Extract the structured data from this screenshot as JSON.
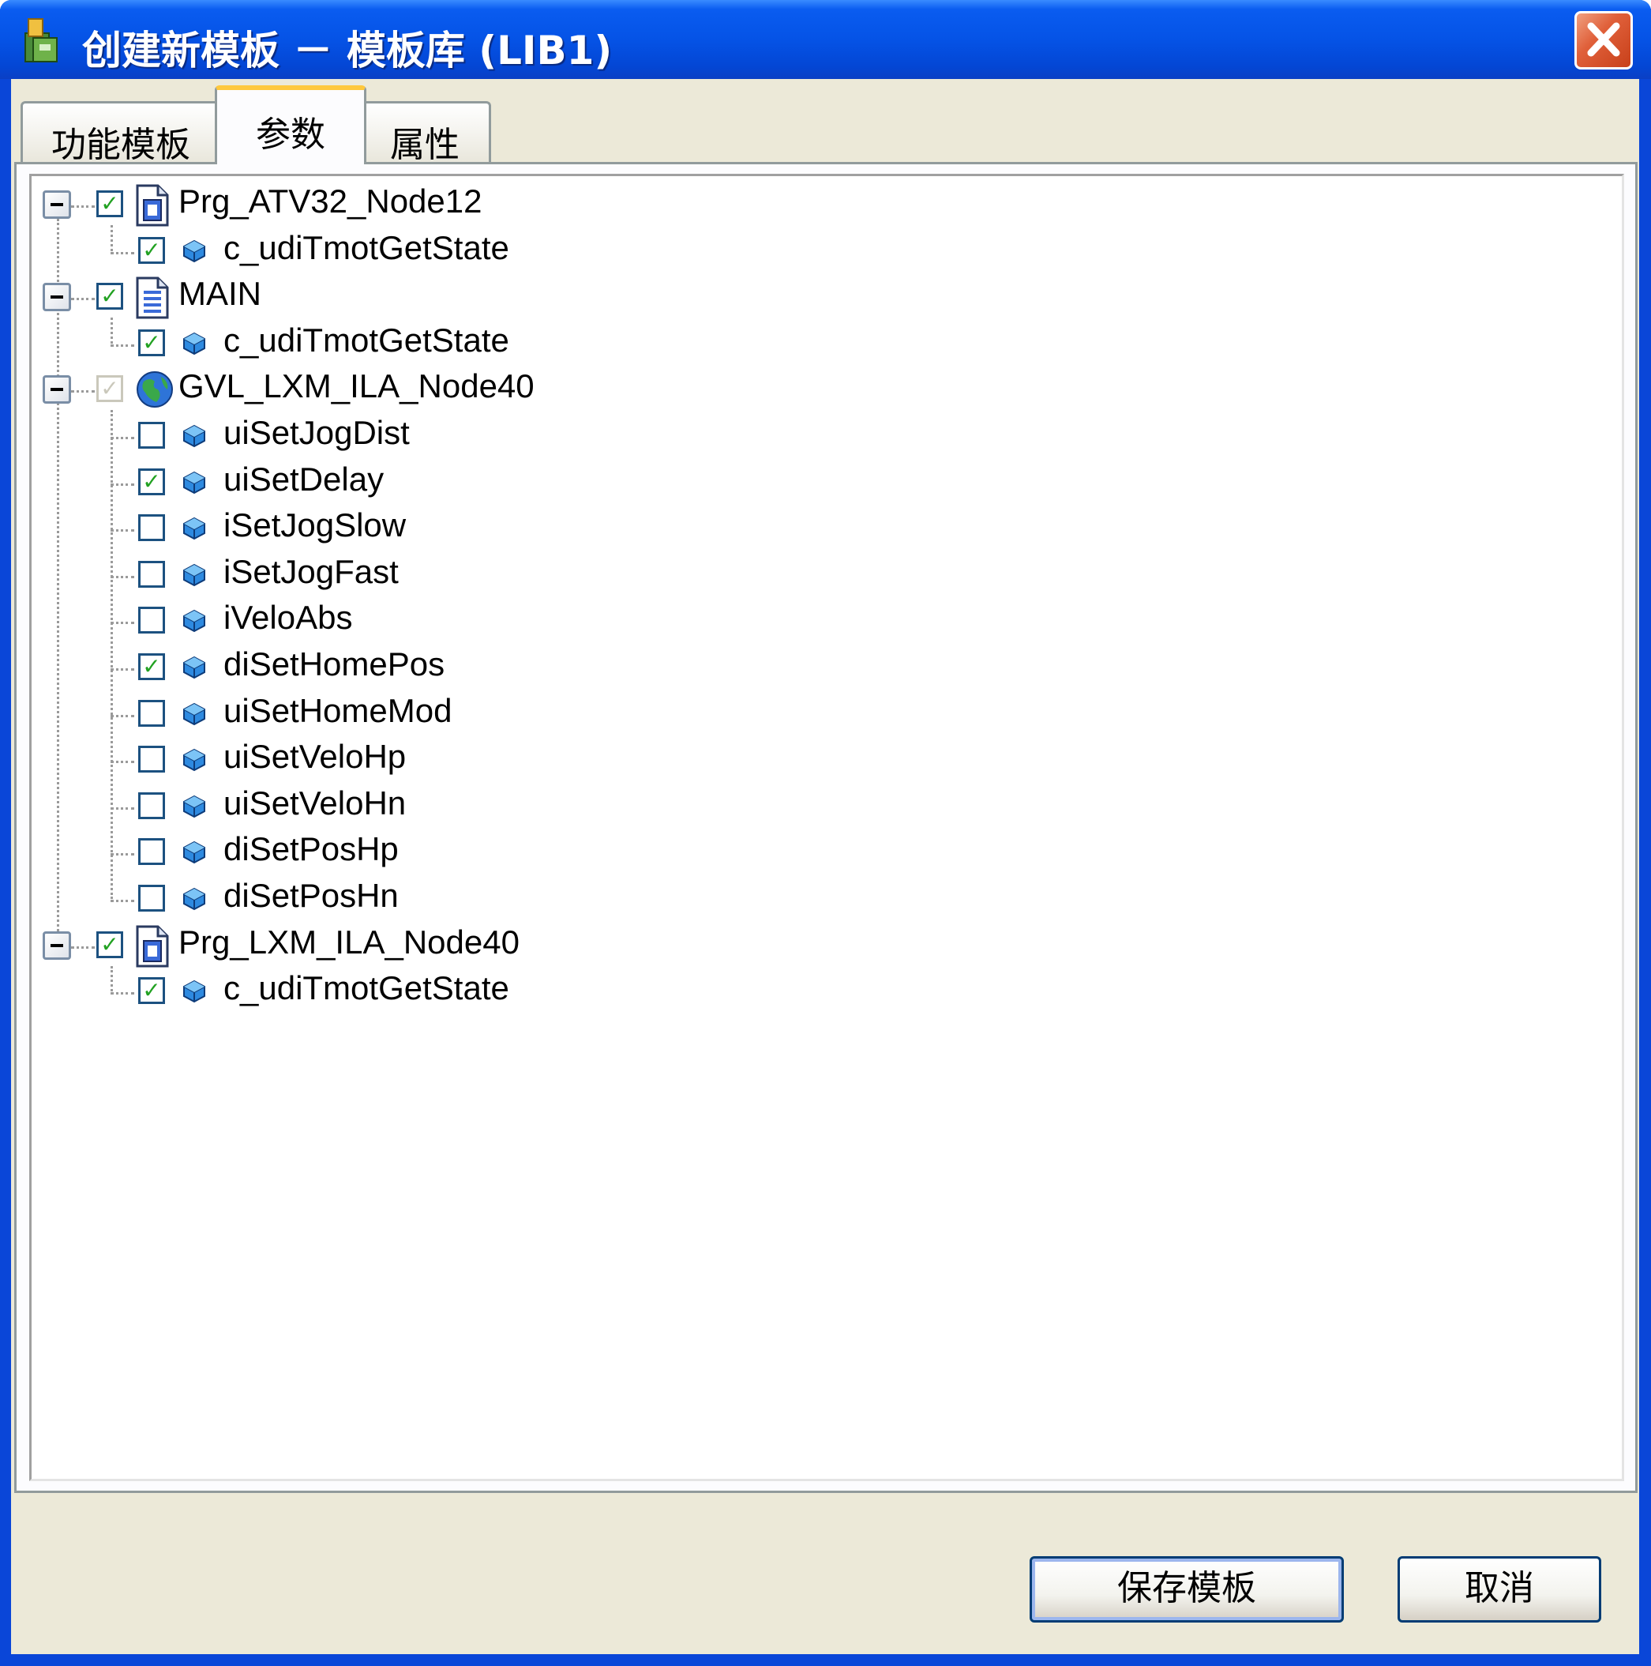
{
  "window": {
    "title": "创建新模板 － 模板库 (LIB1)"
  },
  "tabs": [
    {
      "label": "功能模板"
    },
    {
      "label": "参数"
    },
    {
      "label": "属性"
    }
  ],
  "active_tab": "参数",
  "tree": {
    "groups": [
      {
        "label": "Prg_ATV32_Node12",
        "icon": "program-icon",
        "checked": true,
        "items": [
          {
            "label": "c_udiTmotGetState",
            "checked": true
          }
        ]
      },
      {
        "label": "MAIN",
        "icon": "document-icon",
        "checked": true,
        "items": [
          {
            "label": "c_udiTmotGetState",
            "checked": true
          }
        ]
      },
      {
        "label": "GVL_LXM_ILA_Node40",
        "icon": "globe-icon",
        "checked": true,
        "disabled": true,
        "items": [
          {
            "label": "uiSetJogDist",
            "checked": false
          },
          {
            "label": "uiSetDelay",
            "checked": true
          },
          {
            "label": "iSetJogSlow",
            "checked": false
          },
          {
            "label": "iSetJogFast",
            "checked": false
          },
          {
            "label": "iVeloAbs",
            "checked": false
          },
          {
            "label": "diSetHomePos",
            "checked": true
          },
          {
            "label": "uiSetHomeMod",
            "checked": false
          },
          {
            "label": "uiSetVeloHp",
            "checked": false
          },
          {
            "label": "uiSetVeloHn",
            "checked": false
          },
          {
            "label": "diSetPosHp",
            "checked": false
          },
          {
            "label": "diSetPosHn",
            "checked": false
          }
        ]
      },
      {
        "label": "Prg_LXM_ILA_Node40",
        "icon": "program-icon",
        "checked": true,
        "items": [
          {
            "label": "c_udiTmotGetState",
            "checked": true
          }
        ]
      }
    ]
  },
  "buttons": {
    "save": "保存模板",
    "cancel": "取消"
  },
  "check_mark": "✓"
}
